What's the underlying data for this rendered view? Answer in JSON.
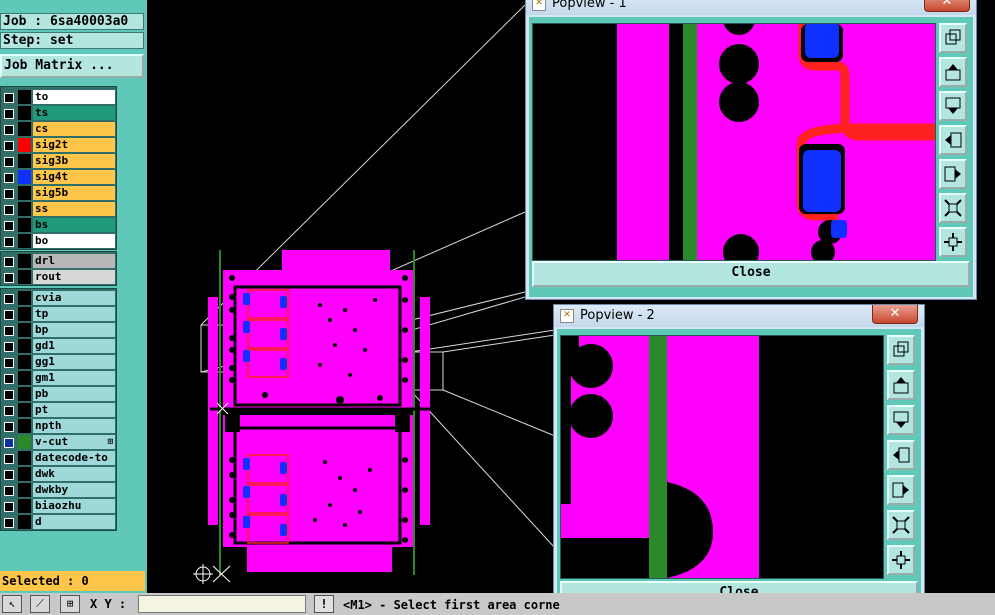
{
  "header": {
    "job": "Job : 6sa40003a0",
    "step": "Step: set",
    "job_matrix_label": "Job Matrix ..."
  },
  "layers_board": [
    {
      "name": "to",
      "color": "#ffffff",
      "swatch": "#000000"
    },
    {
      "name": "ts",
      "color": "#1f9a7a",
      "swatch": "#000000"
    },
    {
      "name": "cs",
      "color": "#ffc64a",
      "swatch": "#000000"
    },
    {
      "name": "sig2t",
      "color": "#ffc64a",
      "swatch": "#ff0000"
    },
    {
      "name": "sig3b",
      "color": "#ffc64a",
      "swatch": "#000000"
    },
    {
      "name": "sig4t",
      "color": "#ffc64a",
      "swatch": "#1030ff"
    },
    {
      "name": "sig5b",
      "color": "#ffc64a",
      "swatch": "#000000"
    },
    {
      "name": "ss",
      "color": "#ffc64a",
      "swatch": "#000000"
    },
    {
      "name": "bs",
      "color": "#1f9a7a",
      "swatch": "#000000"
    },
    {
      "name": "bo",
      "color": "#ffffff",
      "swatch": "#000000"
    }
  ],
  "layers_drill": [
    {
      "name": "drl",
      "color": "#b8b8b8",
      "swatch": "#000000"
    },
    {
      "name": "rout",
      "color": "#d8d8d8",
      "swatch": "#000000"
    }
  ],
  "layers_misc": [
    {
      "name": "cvia",
      "color": "#9ed8d8",
      "swatch": "#000000"
    },
    {
      "name": "tp",
      "color": "#9ed8d8",
      "swatch": "#000000"
    },
    {
      "name": "bp",
      "color": "#9ed8d8",
      "swatch": "#000000"
    },
    {
      "name": "gd1",
      "color": "#9ed8d8",
      "swatch": "#000000"
    },
    {
      "name": "gg1",
      "color": "#9ed8d8",
      "swatch": "#000000"
    },
    {
      "name": "gm1",
      "color": "#9ed8d8",
      "swatch": "#000000"
    },
    {
      "name": "pb",
      "color": "#9ed8d8",
      "swatch": "#000000"
    },
    {
      "name": "pt",
      "color": "#9ed8d8",
      "swatch": "#000000"
    },
    {
      "name": "npth",
      "color": "#9ed8d8",
      "swatch": "#000000"
    },
    {
      "name": "v-cut",
      "color": "#9ed8d8",
      "swatch": "#2a8a2a",
      "mark": "⊞",
      "active": true
    },
    {
      "name": "datecode-to",
      "color": "#9ed8d8",
      "swatch": "#000000"
    },
    {
      "name": "dwk",
      "color": "#9ed8d8",
      "swatch": "#000000"
    },
    {
      "name": "dwkby",
      "color": "#9ed8d8",
      "swatch": "#000000"
    },
    {
      "name": "biaozhu",
      "color": "#9ed8d8",
      "swatch": "#000000"
    },
    {
      "name": "d",
      "color": "#9ed8d8",
      "swatch": "#000000"
    }
  ],
  "selected_label": "Selected : 0",
  "bottombar": {
    "xy_label": "X Y :",
    "xy_value": "",
    "warn_label": "!",
    "status_message": "<M1> - Select first area corne"
  },
  "popup1": {
    "title": "Popview - 1",
    "close_x": "✕",
    "close_button": "Close"
  },
  "popup2": {
    "title": "Popview - 2",
    "close_x": "✕",
    "close_button": "Close"
  },
  "colors": {
    "board": "#ff00ff",
    "trace": "#ff0000",
    "pad": "#1030ff",
    "vcut": "#2a8a2a",
    "panel": "#5fc8b8"
  }
}
